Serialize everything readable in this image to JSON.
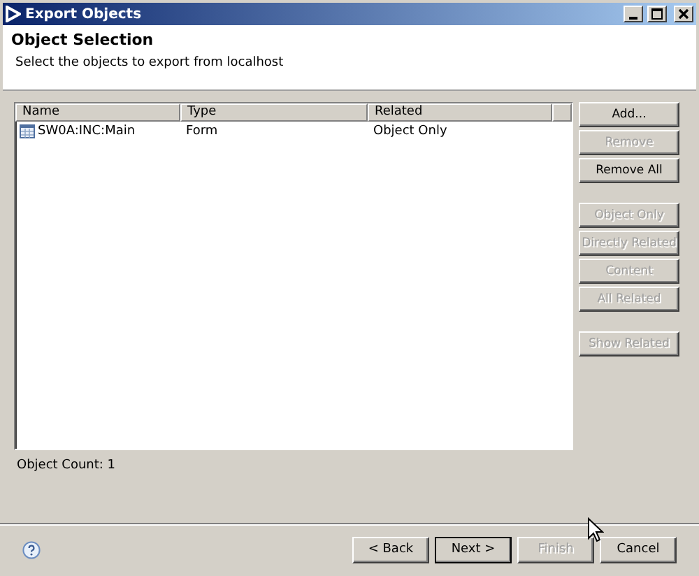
{
  "window": {
    "title": "Export Objects"
  },
  "header": {
    "title": "Object Selection",
    "description": "Select the objects to export from localhost"
  },
  "table": {
    "columns": [
      "Name",
      "Type",
      "Related"
    ],
    "rows": [
      {
        "name": "SW0A:INC:Main",
        "type": "Form",
        "related": "Object Only"
      }
    ]
  },
  "side_button_groups": [
    [
      {
        "label": "Add...",
        "disabled": false
      },
      {
        "label": "Remove",
        "disabled": true
      },
      {
        "label": "Remove All",
        "disabled": false
      }
    ],
    [
      {
        "label": "Object Only",
        "disabled": true
      },
      {
        "label": "Directly Related",
        "disabled": true
      },
      {
        "label": "Content",
        "disabled": true
      },
      {
        "label": "All Related",
        "disabled": true
      }
    ],
    [
      {
        "label": "Show Related",
        "disabled": true
      }
    ]
  ],
  "object_count": "Object Count: 1",
  "footer_buttons": [
    {
      "label": "< Back",
      "disabled": false,
      "default": false
    },
    {
      "label": "Next >",
      "disabled": false,
      "default": true
    },
    {
      "label": "Finish",
      "disabled": true,
      "default": false
    },
    {
      "label": "Cancel",
      "disabled": false,
      "default": false
    }
  ]
}
